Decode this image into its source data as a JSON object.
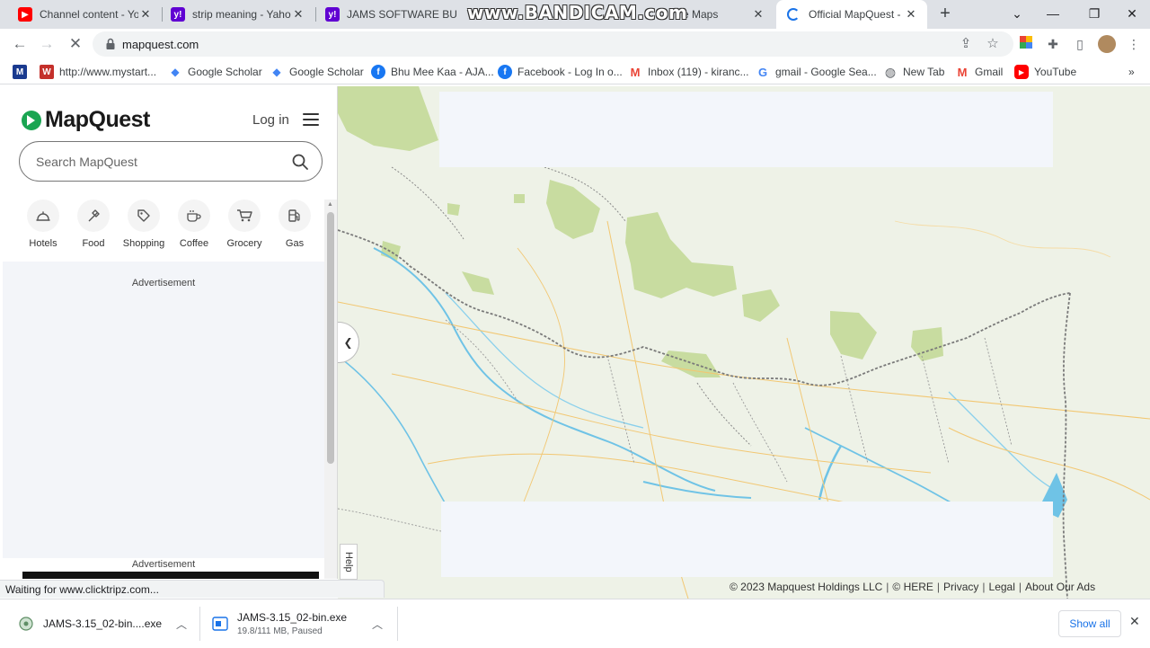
{
  "browser": {
    "tabs": [
      {
        "title": "Channel content - You",
        "favicon": "youtube-icon",
        "color": "#ff0000"
      },
      {
        "title": "strip meaning - Yahoo",
        "favicon": "yahoo-icon",
        "color": "#6001d2"
      },
      {
        "title": "JAMS SOFTWARE BUI",
        "favicon": "yahoo-icon",
        "color": "#6001d2"
      },
      {
        "title": "e Maps",
        "favicon": "",
        "color": ""
      },
      {
        "title": "Official MapQuest - M",
        "favicon": "loading-spinner-icon",
        "color": "#1a73e8",
        "active": true
      }
    ],
    "recording_watermark": "www.BANDICAM.com",
    "url": "mapquest.com",
    "bookmarks": [
      {
        "label": "",
        "icon": "M",
        "color": "#1a3a8f"
      },
      {
        "label": "http://www.mystart...",
        "icon": "W",
        "color": "#c4302b"
      },
      {
        "label": "Google Scholar",
        "icon": "scholar",
        "color": "#4285f4"
      },
      {
        "label": "Google Scholar",
        "icon": "scholar",
        "color": "#4285f4"
      },
      {
        "label": "Bhu Mee Kaa - AJA...",
        "icon": "f",
        "color": "#1877f2"
      },
      {
        "label": "Facebook - Log In o...",
        "icon": "f",
        "color": "#1877f2"
      },
      {
        "label": "Inbox (119) - kiranc...",
        "icon": "M",
        "color": "#ea4335"
      },
      {
        "label": "gmail - Google Sea...",
        "icon": "G",
        "color": "#4285f4"
      },
      {
        "label": "New Tab",
        "icon": "globe",
        "color": "#5f6368"
      },
      {
        "label": "Gmail",
        "icon": "M",
        "color": "#ea4335"
      },
      {
        "label": "YouTube",
        "icon": "yt",
        "color": "#ff0000"
      }
    ],
    "status_text": "Waiting for www.clicktripz.com..."
  },
  "mapquest": {
    "brand": "MapQuest",
    "login_label": "Log in",
    "search_placeholder": "Search MapQuest",
    "categories": [
      {
        "label": "Hotels",
        "icon": "hotel-bell-icon"
      },
      {
        "label": "Food",
        "icon": "utensils-icon"
      },
      {
        "label": "Shopping",
        "icon": "tag-icon"
      },
      {
        "label": "Coffee",
        "icon": "coffee-cup-icon"
      },
      {
        "label": "Grocery",
        "icon": "cart-icon"
      },
      {
        "label": "Gas",
        "icon": "gas-pump-icon"
      }
    ],
    "ad_label_1": "Advertisement",
    "ad_label_2": "Advertisement",
    "help_label": "Help",
    "footer": {
      "copyright": "© 2023 Mapquest Holdings LLC",
      "here": "© HERE",
      "privacy": "Privacy",
      "legal": "Legal",
      "ads": "About Our Ads"
    }
  },
  "downloads": [
    {
      "name": "JAMS-3.15_02-bin....exe",
      "sub": ""
    },
    {
      "name": "JAMS-3.15_02-bin.exe",
      "sub": "19.8/111 MB, Paused"
    }
  ],
  "show_all_label": "Show all"
}
